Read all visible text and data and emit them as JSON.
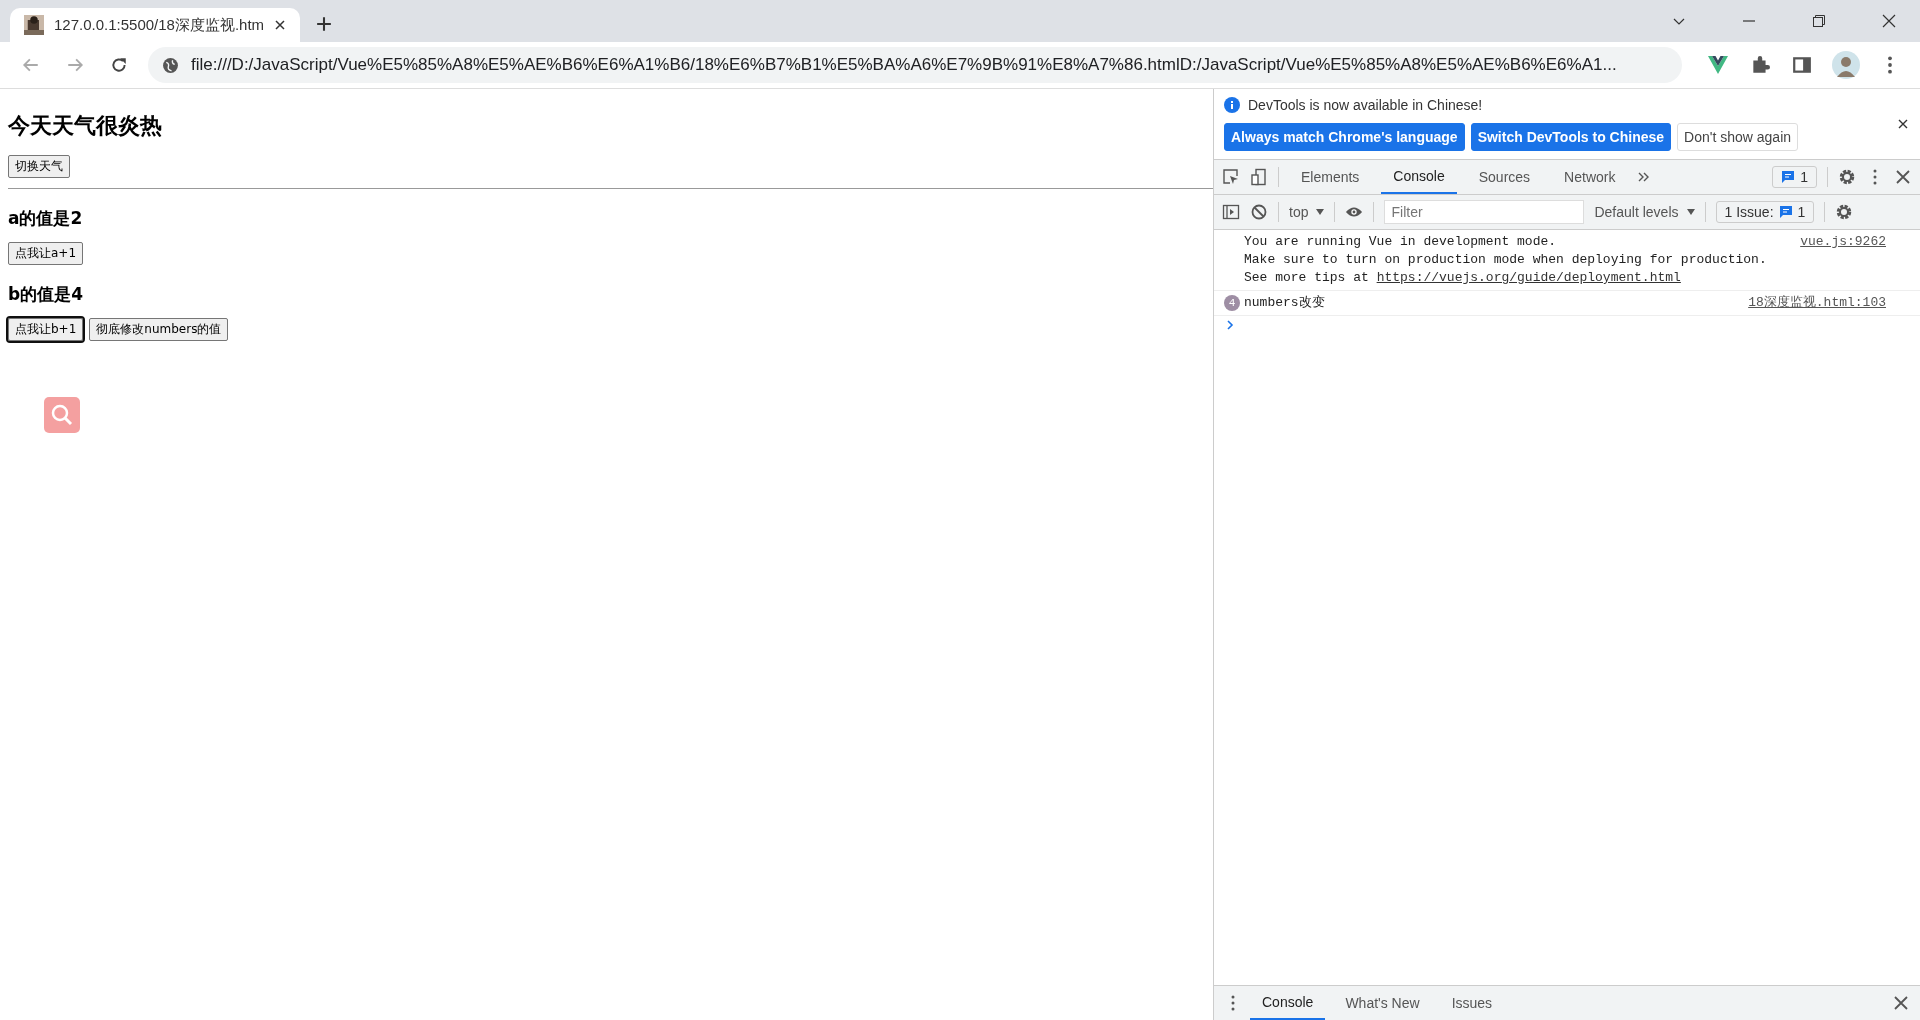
{
  "browser": {
    "tabs": [
      {
        "title": "127.0.0.1:5500/18深度监视.htm",
        "selected": true
      }
    ],
    "address": "file:///D:/JavaScript/Vue%E5%85%A8%E5%AE%B6%E6%A1%B6/18%E6%B7%B1%E5%BA%A6%E7%9B%91%E8%A7%86.htmlD:/JavaScript/Vue%E5%85%A8%E5%AE%B6%E6%A1..."
  },
  "page": {
    "title": "今天天气很炎热",
    "weather_button": "切换天气",
    "a_text": "a的值是2",
    "a_button": "点我让a+1",
    "b_text": "b的值是4",
    "b_buttons": [
      {
        "label": "点我让b+1",
        "focused": true
      },
      {
        "label": "彻底修改numbers的值",
        "focused": false
      }
    ]
  },
  "devtools": {
    "banner": {
      "message": "DevTools is now available in Chinese!",
      "buttons": [
        {
          "label": "Always match Chrome's language",
          "kind": "primary"
        },
        {
          "label": "Switch DevTools to Chinese",
          "kind": "primary"
        },
        {
          "label": "Don't show again",
          "kind": "plain"
        }
      ]
    },
    "tabs": [
      {
        "label": "Elements",
        "selected": false
      },
      {
        "label": "Console",
        "selected": true
      },
      {
        "label": "Sources",
        "selected": false
      },
      {
        "label": "Network",
        "selected": false
      }
    ],
    "message_count": "1",
    "console_toolbar": {
      "context": "top",
      "filter_placeholder": "Filter",
      "levels": "Default levels",
      "issues": "1 Issue:",
      "issues_count": "1"
    },
    "messages": [
      {
        "kind": "info",
        "lines": [
          "You are running Vue in development mode.",
          "Make sure to turn on production mode when deploying for production."
        ],
        "tip": "See more tips at",
        "link": "https://vuejs.org/guide/deployment.html",
        "source": "vue.js:9262"
      },
      {
        "kind": "repeat",
        "count": "4",
        "text": "numbers改变",
        "source": "18深度监视.html:103"
      }
    ],
    "drawer_tabs": [
      {
        "label": "Console",
        "selected": true
      },
      {
        "label": "What's New",
        "selected": false
      },
      {
        "label": "Issues",
        "selected": false
      }
    ]
  }
}
